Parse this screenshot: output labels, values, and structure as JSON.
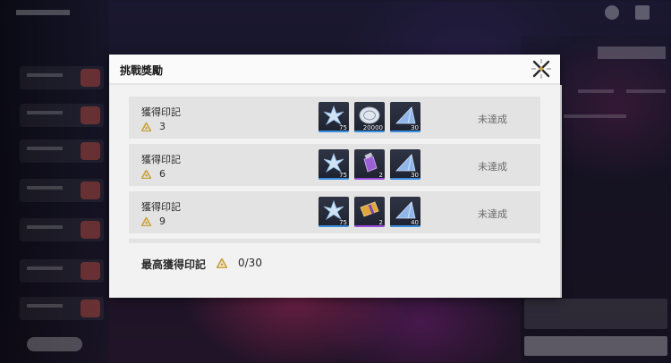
{
  "dialog": {
    "title": "挑戰獎勵",
    "close_icon": "close-x-icon"
  },
  "rewards": [
    {
      "label": "獲得印記",
      "count": "3",
      "status": "未達成",
      "items": [
        {
          "icon": "crystal-star-icon",
          "qty": "75",
          "rarity_color": "#3a8fe0"
        },
        {
          "icon": "silver-coin-icon",
          "qty": "20000",
          "rarity_color": "#3a8fe0"
        },
        {
          "icon": "blue-prism-icon",
          "qty": "30",
          "rarity_color": "#3a8fe0"
        }
      ]
    },
    {
      "label": "獲得印記",
      "count": "6",
      "status": "未達成",
      "items": [
        {
          "icon": "crystal-star-icon",
          "qty": "75",
          "rarity_color": "#3a8fe0"
        },
        {
          "icon": "purple-vial-icon",
          "qty": "2",
          "rarity_color": "#9b4de0"
        },
        {
          "icon": "blue-prism-icon",
          "qty": "30",
          "rarity_color": "#3a8fe0"
        }
      ]
    },
    {
      "label": "獲得印記",
      "count": "9",
      "status": "未達成",
      "items": [
        {
          "icon": "crystal-star-icon",
          "qty": "75",
          "rarity_color": "#3a8fe0"
        },
        {
          "icon": "gold-vial-icon",
          "qty": "2",
          "rarity_color": "#9b4de0"
        },
        {
          "icon": "blue-prism-icon",
          "qty": "40",
          "rarity_color": "#3a8fe0"
        }
      ]
    }
  ],
  "footer": {
    "label": "最高獲得印記",
    "value": "0/30",
    "icon": "mark-triangle-icon"
  },
  "colors": {
    "mark_gold": "#c9a23a",
    "dialog_bg": "#f2f2f2",
    "row_bg": "#e3e3e3"
  }
}
